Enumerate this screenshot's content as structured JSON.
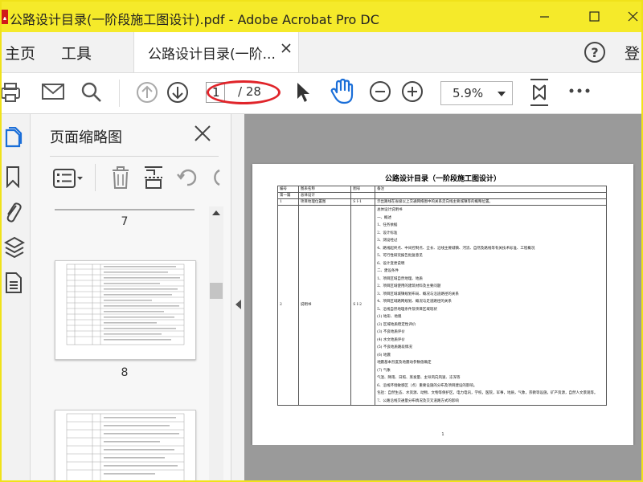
{
  "window": {
    "title": "公路设计目录(一阶段施工图设计).pdf - Adobe Acrobat Pro DC",
    "accent_color": "#f5ea2a"
  },
  "menu": {
    "home": "主页",
    "tools": "工具",
    "doc_tab_label": "公路设计目录(一阶...",
    "login": "登"
  },
  "toolbar": {
    "current_page": "1",
    "page_total": "/ 28",
    "zoom": "5.9%"
  },
  "panel": {
    "title": "页面缩略图",
    "thumbnails": [
      {
        "label": "7"
      },
      {
        "label": "8"
      }
    ]
  },
  "document": {
    "title": "公路设计目录（一阶段施工图设计）",
    "page_number": "1",
    "headers": [
      "编号",
      "图表名称",
      "图号",
      "备注"
    ],
    "row_chapter": {
      "col1": "第一篇",
      "col2": "总体设计"
    },
    "row1": {
      "num": "1",
      "name": "项目地理位置图",
      "code": "S I-1",
      "note": "示出路线在省级以上交通网络图中的关系走向线主要城镇等的概略位置。"
    },
    "row2": {
      "num": "2",
      "name": "说明书",
      "code": "S I-2"
    },
    "notes": [
      "总体设计说明书",
      "一、概述",
      "1、任务依据",
      "2、设计标准",
      "3、测设经过",
      "4、路线起终点、中间控制点、全长、沿线主要城镇、河流、自然及路线等有关技术标准、工程概况",
      "5、可行性研究报告批复意见",
      "6、设计变更说明",
      "二、建设条件",
      "1、项目区域自然地理、地质",
      "2、项目区域使用的建筑材料及主要问题",
      "3、项目区域城镇规划布局、概况与沿途路径的关系",
      "4、项目区域路网规划、概况与走道路径的关系",
      "5、沿线自然地理条件及项目区域现状",
      "(1) 地形、地貌",
      "(2) 区域地质稳定性评价",
      "(3) 不良地质评价",
      "(4) 水文地质评价",
      "(5) 不良地质路段情况",
      "(6) 地震",
      "地震基本烈度及地震动参数值确定",
      "(7) 气象",
      "气温、降雨、日照、蒸发量、主导风向风速、冻深等",
      "6、沿线环境敏感区（点）重要设施的分布及项目建设的影响。",
      "包括：自然生态、水资源、动物、文物等保护区，电力电讯，学校，医院，军事，地质，气象，宗教等设施，矿产资源，自然人文景观等。",
      "7、公路沿线交通量分布情况及交叉道路方式的影响"
    ]
  }
}
